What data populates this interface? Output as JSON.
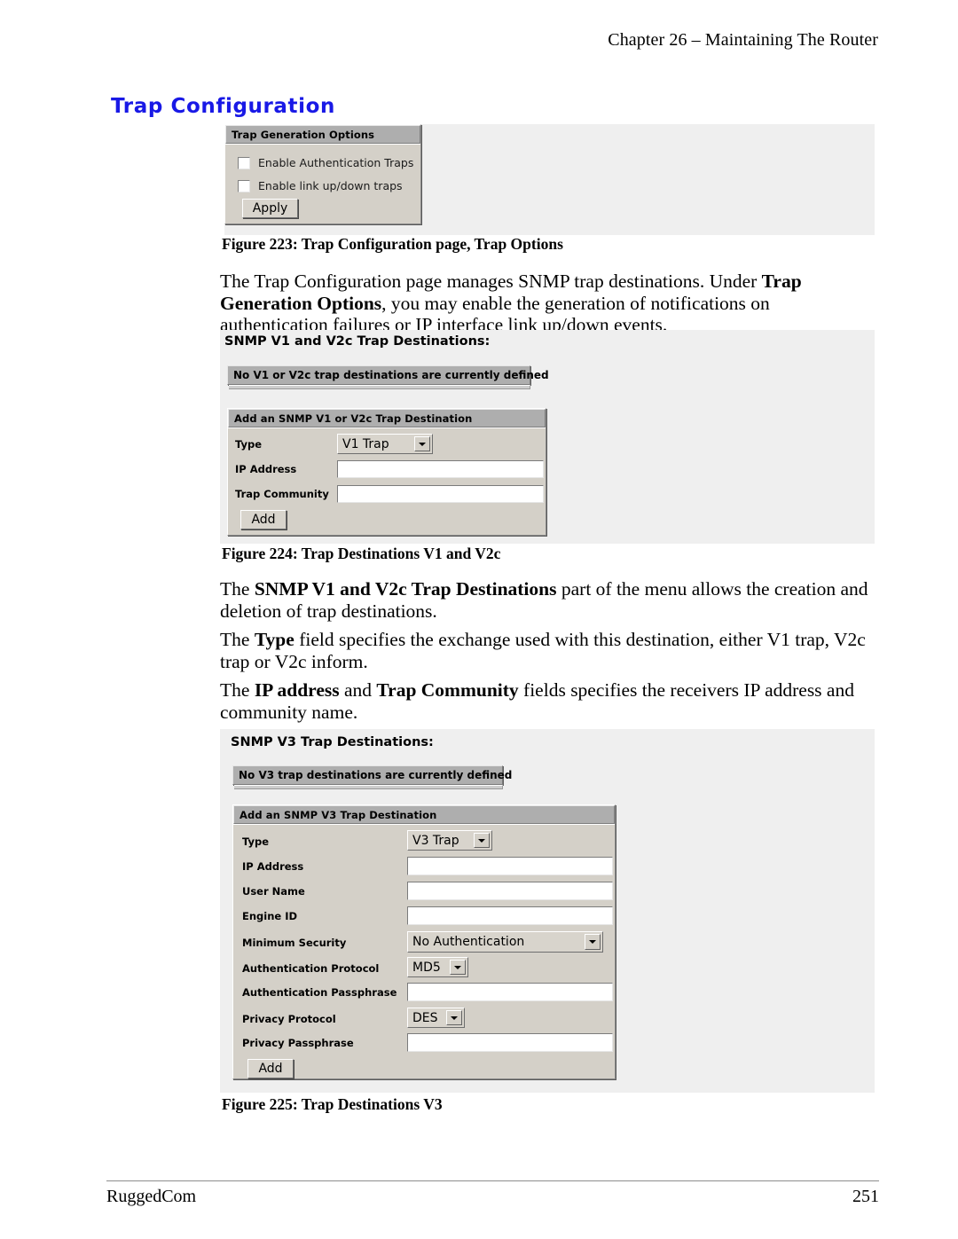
{
  "page": {
    "header_text": "Chapter 26 – Maintaining The Router",
    "section_title": "Trap Configuration",
    "footer_brand": "RuggedCom",
    "footer_page_number": "251",
    "accent_color": "#1919e6"
  },
  "figure223": {
    "caption": "Figure 223: Trap Configuration page, Trap Options",
    "panel_title": "Trap Generation Options",
    "checkbox1_label": "Enable Authentication Traps",
    "checkbox2_label": "Enable link up/down traps",
    "apply_button": "Apply"
  },
  "paragraph1": {
    "line1_a": "The Trap Configuration page manages SNMP trap destinations.  Under ",
    "line1_b": "Trap Generation Options",
    "line1_c": ", you may enable the generation of notifications on authentication failures or IP interface link up/down events."
  },
  "figure224": {
    "caption": "Figure 224: Trap Destinations V1 and V2c",
    "heading": "SNMP V1 and V2c Trap Destinations:",
    "status_message": "No V1 or V2c trap destinations are currently defined",
    "panel_title": "Add an SNMP V1 or V2c Trap Destination",
    "fields": [
      {
        "label": "Type",
        "kind": "select",
        "value": "V1 Trap"
      },
      {
        "label": "IP Address",
        "kind": "text",
        "value": ""
      },
      {
        "label": "Trap Community",
        "kind": "text",
        "value": ""
      }
    ],
    "add_button": "Add"
  },
  "paragraph2": {
    "a": "The ",
    "b": "SNMP V1 and V2c Trap Destinations",
    "c": " part of the menu allows the creation and deletion of trap destinations."
  },
  "paragraph3": {
    "a": "The ",
    "b": "Type",
    "c": " field specifies the exchange used with this destination, either V1 trap, V2c trap or V2c inform."
  },
  "paragraph4": {
    "a": "The ",
    "b": "IP address",
    "c": " and ",
    "d": "Trap Community",
    "e": " fields specifies the receivers IP address and community name."
  },
  "figure225": {
    "caption": "Figure 225: Trap Destinations V3",
    "heading": "SNMP V3 Trap Destinations:",
    "status_message": "No V3 trap destinations are currently defined",
    "panel_title": "Add an SNMP V3 Trap Destination",
    "fields": [
      {
        "label": "Type",
        "kind": "select",
        "value": "V3 Trap"
      },
      {
        "label": "IP Address",
        "kind": "text",
        "value": ""
      },
      {
        "label": "User Name",
        "kind": "text",
        "value": ""
      },
      {
        "label": "Engine ID",
        "kind": "text",
        "value": ""
      },
      {
        "label": "Minimum Security",
        "kind": "select",
        "value": "No Authentication"
      },
      {
        "label": "Authentication Protocol",
        "kind": "select",
        "value": "MD5"
      },
      {
        "label": "Authentication Passphrase",
        "kind": "text",
        "value": ""
      },
      {
        "label": "Privacy Protocol",
        "kind": "select",
        "value": "DES"
      },
      {
        "label": "Privacy Passphrase",
        "kind": "text",
        "value": ""
      }
    ],
    "add_button": "Add"
  }
}
